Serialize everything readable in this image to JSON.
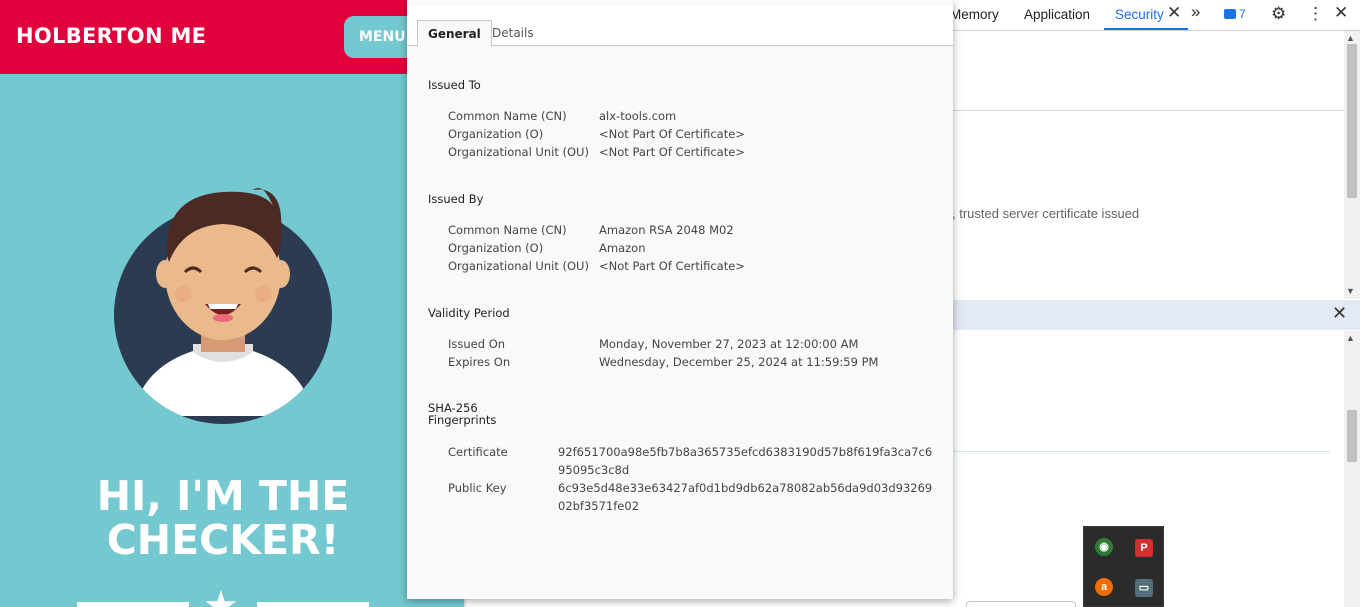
{
  "webpage": {
    "brand": "HOLBERTON ME",
    "menu_label": "MENU",
    "menu_icon": "hamburger-icon",
    "hero_line1": "HI, I'M THE",
    "hero_line2": "CHECKER!",
    "colors": {
      "header": "#e2003c",
      "background": "#74c9d0"
    }
  },
  "devtools": {
    "tabs": [
      "Memory",
      "Application",
      "Security"
    ],
    "active_tab": "Security",
    "issues_count": "7",
    "security_text": ", trusted server certificate issued",
    "icons": [
      "close-tab-icon",
      "more-tabs-icon",
      "issues-icon",
      "settings-gear-icon",
      "kebab-menu-icon",
      "close-devtools-icon"
    ]
  },
  "certificate": {
    "tabs": {
      "general": "General",
      "details": "Details"
    },
    "issued_to": {
      "heading": "Issued To",
      "rows": [
        {
          "label": "Common Name (CN)",
          "value": "alx-tools.com"
        },
        {
          "label": "Organization (O)",
          "value": "<Not Part Of Certificate>"
        },
        {
          "label": "Organizational Unit (OU)",
          "value": "<Not Part Of Certificate>"
        }
      ]
    },
    "issued_by": {
      "heading": "Issued By",
      "rows": [
        {
          "label": "Common Name (CN)",
          "value": "Amazon RSA 2048 M02"
        },
        {
          "label": "Organization (O)",
          "value": "Amazon"
        },
        {
          "label": "Organizational Unit (OU)",
          "value": "<Not Part Of Certificate>"
        }
      ]
    },
    "validity": {
      "heading": "Validity Period",
      "rows": [
        {
          "label": "Issued On",
          "value": "Monday, November 27, 2023 at 12:00:00 AM"
        },
        {
          "label": "Expires On",
          "value": "Wednesday, December 25, 2024 at 11:59:59 PM"
        }
      ]
    },
    "fingerprints": {
      "heading_line1": "SHA-256",
      "heading_line2": "Fingerprints",
      "rows": [
        {
          "label": "Certificate",
          "value": "92f651700a98e5fb7b8a365735efcd6383190d57b8f619fa3ca7c695095c3c8d"
        },
        {
          "label": "Public Key",
          "value": "6c93e5d48e33e63427af0d1bd9db62a78082ab56da9d03d9326902bf3571fe02"
        }
      ]
    }
  },
  "tray": {
    "icons": [
      "network-globe-icon",
      "pocket-icon",
      "avast-icon",
      "display-monitor-icon"
    ]
  }
}
